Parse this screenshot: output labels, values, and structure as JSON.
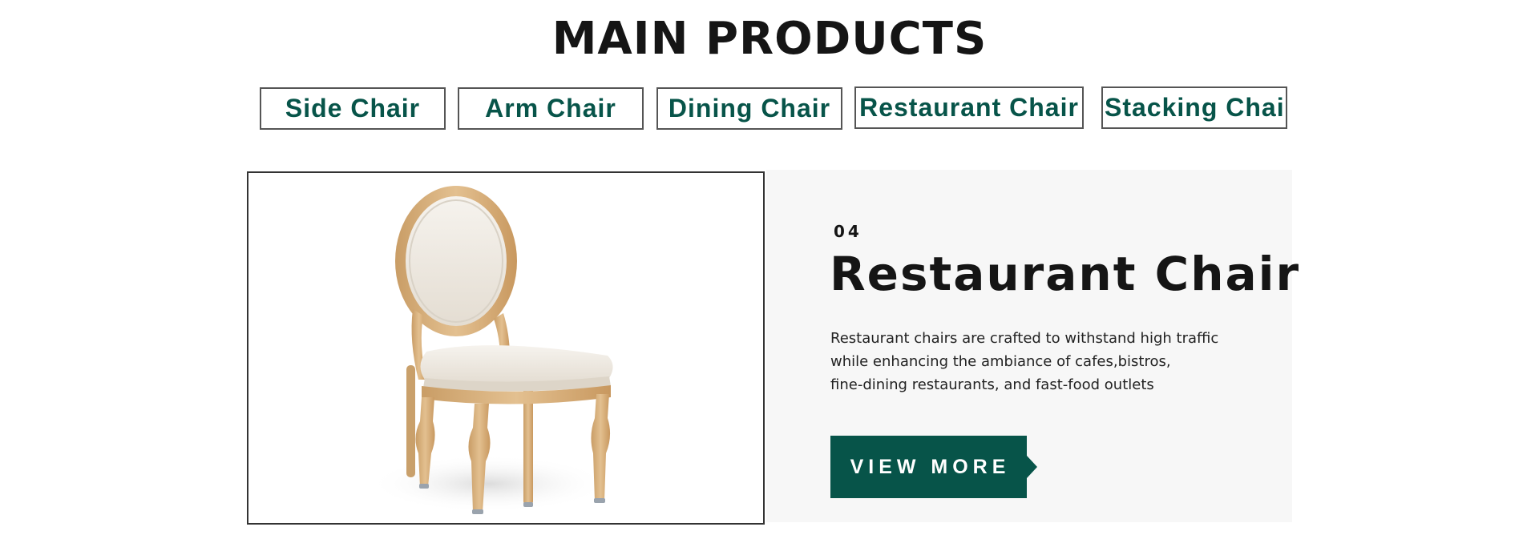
{
  "section": {
    "title": "MAIN PRODUCTS"
  },
  "tabs": [
    {
      "label": "Side Chair"
    },
    {
      "label": "Arm Chair"
    },
    {
      "label": "Dining Chair"
    },
    {
      "label": "Restaurant Chair"
    },
    {
      "label": "Stacking Chair"
    }
  ],
  "product": {
    "index": "04",
    "title": "Restaurant Chair",
    "description_lines": [
      "Restaurant chairs are crafted to withstand high traffic",
      "while enhancing the ambiance of cafes,bistros,",
      "fine-dining restaurants, and fast-food outlets"
    ],
    "cta_label": "VIEW MORE",
    "image_icon": "chair-photo-icon"
  },
  "colors": {
    "accent": "#075449",
    "title_text": "#151515",
    "panel_background": "#f7f7f7",
    "tab_border": "#555555",
    "chair_wood": "#d9b485",
    "chair_upholstery": "#f1ede6"
  }
}
